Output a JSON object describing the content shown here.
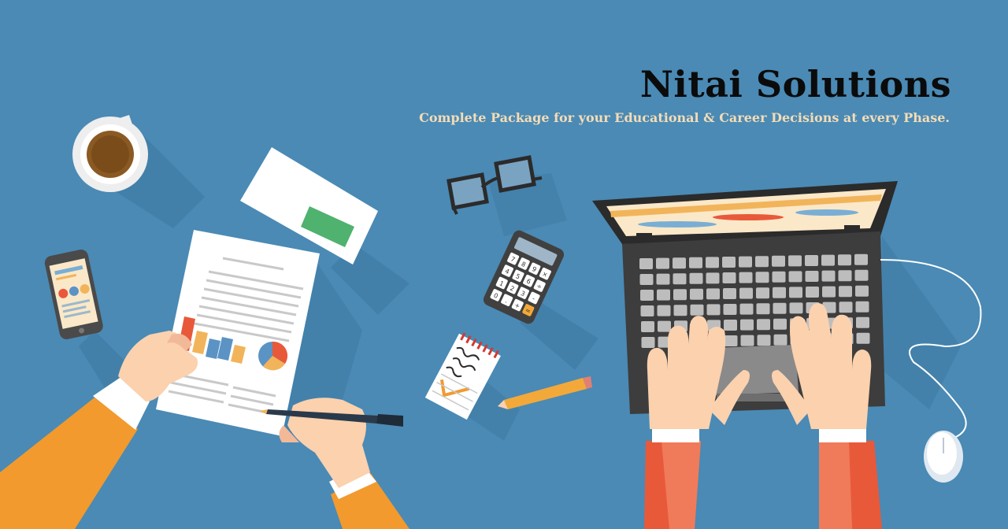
{
  "brand": {
    "title": "Nitai Solutions",
    "tagline": "Complete Package for your Educational & Career Decisions at every Phase."
  },
  "calculator": {
    "keys": [
      "7",
      "8",
      "9",
      "×",
      "4",
      "5",
      "6",
      "÷",
      "1",
      "2",
      "3",
      "-",
      "0",
      ".",
      "+",
      "="
    ]
  },
  "colors": {
    "background": "#4a8ab5",
    "title": "#0b0b0b",
    "tagline": "#f4dcb6",
    "sleeve_orange": "#f29a2e",
    "sleeve_red": "#e8593a",
    "laptop": "#3d3d3d"
  }
}
